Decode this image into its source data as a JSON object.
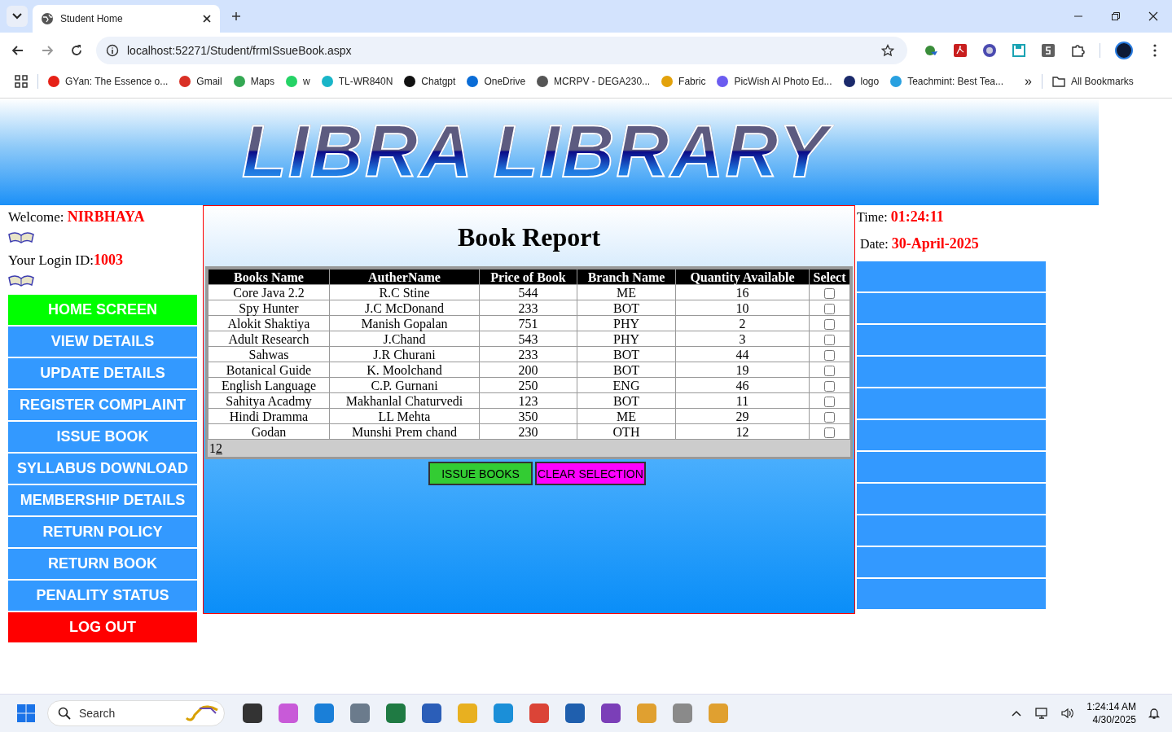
{
  "browser": {
    "tab_title": "Student Home",
    "url": "localhost:52271/Student/frmISsueBook.aspx",
    "bookmarks": [
      {
        "label": "GYan: The Essence o..."
      },
      {
        "label": "Gmail"
      },
      {
        "label": "Maps"
      },
      {
        "label": "w"
      },
      {
        "label": "TL-WR840N"
      },
      {
        "label": "Chatgpt"
      },
      {
        "label": "OneDrive"
      },
      {
        "label": "MCRPV - DEGA230..."
      },
      {
        "label": "Fabric"
      },
      {
        "label": "PicWish AI Photo Ed..."
      },
      {
        "label": "logo"
      },
      {
        "label": "Teachmint: Best Tea..."
      }
    ],
    "more": "»",
    "all_bookmarks": "All Bookmarks"
  },
  "header": {
    "logo_text": "LIBRA LIBRARY"
  },
  "sidebar": {
    "welcome_label": "Welcome:",
    "user_name": "NIRBHAYA",
    "login_label": "Your Login ID:",
    "login_id": "1003",
    "nav": [
      {
        "label": "HOME SCREEN",
        "kind": "home"
      },
      {
        "label": "VIEW DETAILS",
        "kind": "normal"
      },
      {
        "label": "UPDATE DETAILS",
        "kind": "normal"
      },
      {
        "label": "REGISTER COMPLAINT",
        "kind": "normal"
      },
      {
        "label": "ISSUE BOOK",
        "kind": "normal"
      },
      {
        "label": "SYLLABUS DOWNLOAD",
        "kind": "normal"
      },
      {
        "label": "MEMBERSHIP DETAILS",
        "kind": "normal"
      },
      {
        "label": "RETURN POLICY",
        "kind": "normal"
      },
      {
        "label": "RETURN BOOK",
        "kind": "normal"
      },
      {
        "label": "PENALITY STATUS",
        "kind": "normal"
      },
      {
        "label": "LOG OUT",
        "kind": "logout"
      }
    ]
  },
  "report": {
    "title": "Book Report",
    "columns": [
      "Books Name",
      "AutherName",
      "Price of Book",
      "Branch Name",
      "Quantity Available",
      "Select"
    ],
    "rows": [
      {
        "cells": [
          "Core Java 2.2",
          "R.C Stine",
          "544",
          "ME",
          "16"
        ],
        "checked": false
      },
      {
        "cells": [
          "Spy Hunter",
          "J.C McDonand",
          "233",
          "BOT",
          "10"
        ],
        "checked": false
      },
      {
        "cells": [
          "Alokit Shaktiya",
          "Manish Gopalan",
          "751",
          "PHY",
          "2"
        ],
        "checked": false
      },
      {
        "cells": [
          "Adult Research",
          "J.Chand",
          "543",
          "PHY",
          "3"
        ],
        "checked": false
      },
      {
        "cells": [
          "Sahwas",
          "J.R Churani",
          "233",
          "BOT",
          "44"
        ],
        "checked": false
      },
      {
        "cells": [
          "Botanical Guide",
          "K. Moolchand",
          "200",
          "BOT",
          "19"
        ],
        "checked": false
      },
      {
        "cells": [
          "English Language",
          "C.P. Gurnani",
          "250",
          "ENG",
          "46"
        ],
        "checked": false
      },
      {
        "cells": [
          "Sahitya Acadmy",
          "Makhanlal Chaturvedi",
          "123",
          "BOT",
          "11"
        ],
        "checked": false
      },
      {
        "cells": [
          "Hindi Dramma",
          "LL Mehta",
          "350",
          "ME",
          "29"
        ],
        "checked": false
      },
      {
        "cells": [
          "Godan",
          "Munshi Prem chand",
          "230",
          "OTH",
          "12"
        ],
        "checked": false
      }
    ],
    "pages": [
      {
        "label": "1",
        "selected": true
      },
      {
        "label": "2",
        "selected": false
      }
    ],
    "buttons": [
      {
        "label": "ISSUE BOOKS",
        "kind": "issue"
      },
      {
        "label": "CLEAR SELECTION",
        "kind": "clear"
      }
    ]
  },
  "info": {
    "time_label": "Time:",
    "time": "01:24:11",
    "date_label": "Date:",
    "date": "30-April-2025"
  },
  "taskbar": {
    "search_placeholder": "Search",
    "time": "1:24:14 AM",
    "date": "4/30/2025"
  }
}
